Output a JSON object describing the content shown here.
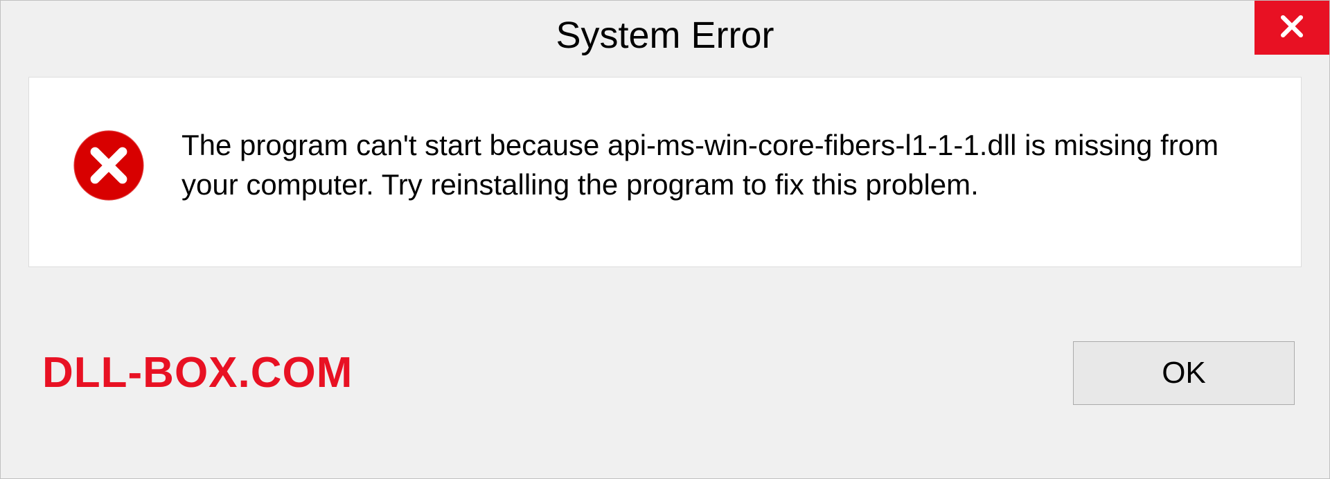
{
  "dialog": {
    "title": "System Error",
    "message": "The program can't start because api-ms-win-core-fibers-l1-1-1.dll is missing from your computer. Try reinstalling the program to fix this problem.",
    "ok_label": "OK"
  },
  "watermark": "DLL-BOX.COM",
  "colors": {
    "accent_red": "#e81123",
    "background": "#f0f0f0",
    "panel": "#ffffff"
  }
}
